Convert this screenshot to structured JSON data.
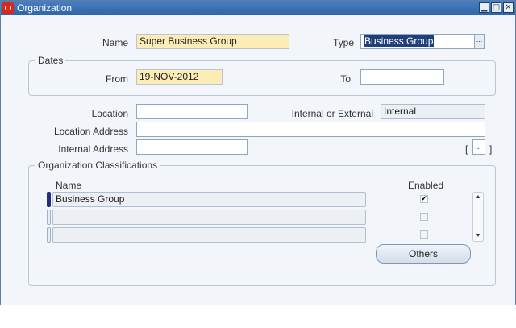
{
  "window": {
    "title": "Organization",
    "buttons": {
      "minimize": "▁",
      "maximize": "□",
      "close": "✕"
    }
  },
  "form": {
    "name_label": "Name",
    "name_value": "Super Business Group",
    "type_label": "Type",
    "type_value": "Business Group",
    "type_lov": "...",
    "dates": {
      "title": "Dates",
      "from_label": "From",
      "from_value": "19-NOV-2012",
      "to_label": "To",
      "to_value": ""
    },
    "location_label": "Location",
    "location_value": "",
    "internal_external_label": "Internal or External",
    "internal_external_value": "Internal",
    "location_address_label": "Location Address",
    "location_address_value": "",
    "internal_address_label": "Internal Address",
    "internal_address_value": "",
    "flex_open": "[",
    "flex_field": "..",
    "flex_close": "]"
  },
  "classifications": {
    "title": "Organization Classifications",
    "name_header": "Name",
    "enabled_header": "Enabled",
    "rows": [
      {
        "name": "Business Group",
        "enabled": true,
        "check": "✔"
      },
      {
        "name": "",
        "enabled": false,
        "check": ""
      },
      {
        "name": "",
        "enabled": false,
        "check": ""
      }
    ],
    "others_button": "Others",
    "scroll_up": "▲",
    "scroll_down": "▼"
  },
  "colors": {
    "titlebar": "#2f64a8",
    "required_field": "#fcedb6",
    "readonly_field": "#eceff3",
    "window_bg": "#f2f6fa",
    "current_record": "#1f2f7a"
  }
}
